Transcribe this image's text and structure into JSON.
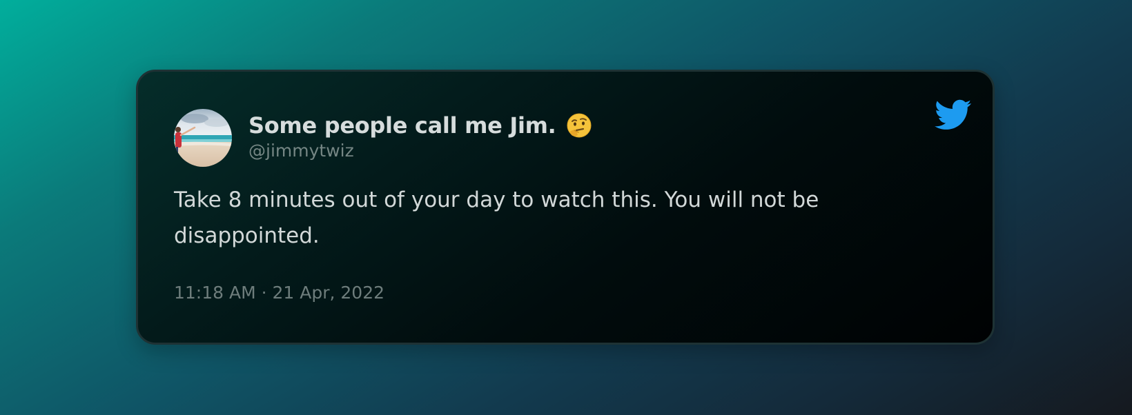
{
  "tweet": {
    "display_name": "Some people call me Jim.",
    "name_emoji": "thinking-face",
    "handle": "@jimmytwiz",
    "text": "Take 8 minutes out of your day to watch this. You will not be disappointed.",
    "timestamp": "11:18 AM · 21 Apr, 2022",
    "brand_icon": "twitter-bird-icon",
    "brand_color": "#1d9bf0"
  }
}
